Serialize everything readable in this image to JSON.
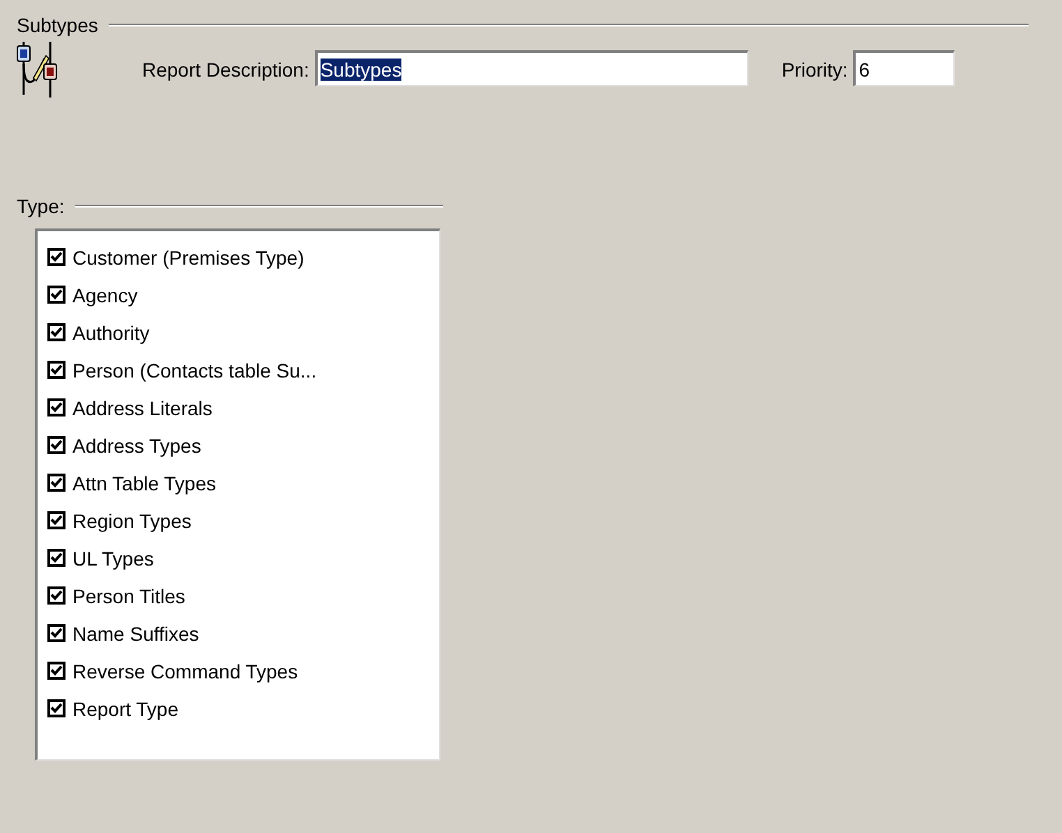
{
  "group": {
    "title": "Subtypes"
  },
  "report_description": {
    "label": "Report Description:",
    "value": "Subtypes",
    "text_selected": true
  },
  "priority": {
    "label": "Priority:",
    "value": "6"
  },
  "type": {
    "label": "Type:",
    "items": [
      {
        "label": "Customer (Premises Type)",
        "checked": true
      },
      {
        "label": "Agency",
        "checked": true
      },
      {
        "label": "Authority",
        "checked": true
      },
      {
        "label": "Person (Contacts table Su...",
        "checked": true
      },
      {
        "label": "Address Literals",
        "checked": true
      },
      {
        "label": "Address Types",
        "checked": true
      },
      {
        "label": "Attn Table Types",
        "checked": true
      },
      {
        "label": "Region Types",
        "checked": true
      },
      {
        "label": "UL Types",
        "checked": true
      },
      {
        "label": "Person Titles",
        "checked": true
      },
      {
        "label": "Name Suffixes",
        "checked": true
      },
      {
        "label": "Reverse Command Types",
        "checked": true
      },
      {
        "label": "Report Type",
        "checked": true
      }
    ]
  }
}
